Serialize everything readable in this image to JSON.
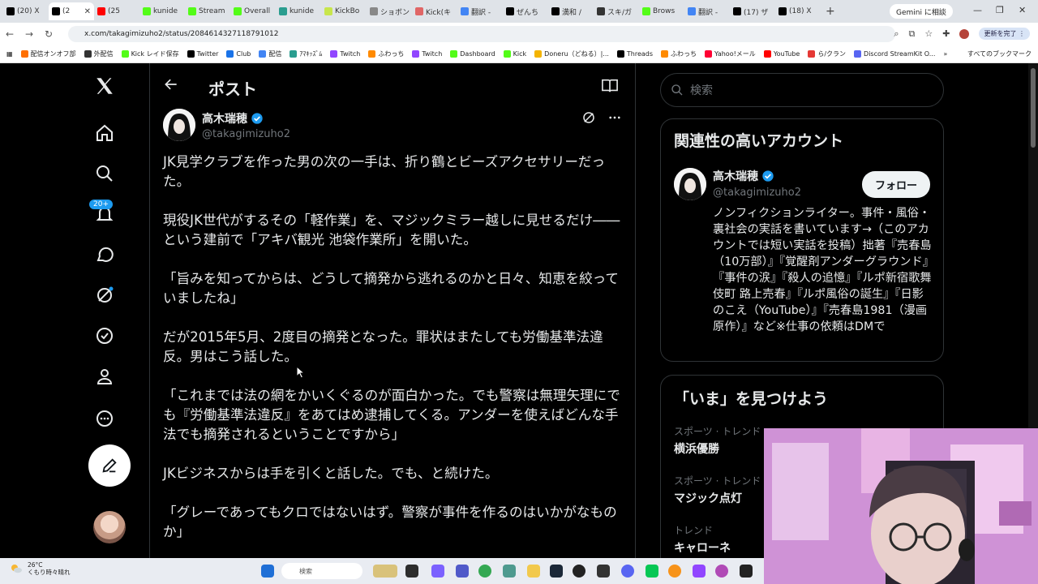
{
  "browser": {
    "tabs": [
      {
        "label": "(20) X",
        "color": "#000000"
      },
      {
        "label": "(2",
        "color": "#000000",
        "active": true
      },
      {
        "label": "(25",
        "color": "#ff0000"
      },
      {
        "label": "kunide",
        "color": "#53fc18"
      },
      {
        "label": "Stream",
        "color": "#53fc18"
      },
      {
        "label": "Overall",
        "color": "#53fc18"
      },
      {
        "label": "kunide",
        "color": "#2a9d8f"
      },
      {
        "label": "KickBo",
        "color": "#c8e64c"
      },
      {
        "label": "ショボン",
        "color": "#888888"
      },
      {
        "label": "Kick(キ",
        "color": "#e06666"
      },
      {
        "label": "翻訳 -",
        "color": "#4285f4"
      },
      {
        "label": "ぜんち",
        "color": "#000000"
      },
      {
        "label": "満和 /",
        "color": "#000000"
      },
      {
        "label": "スキ/ガ",
        "color": "#333333"
      },
      {
        "label": "Brows",
        "color": "#53fc18"
      },
      {
        "label": "翻訳 -",
        "color": "#4285f4"
      },
      {
        "label": "(17) ザ",
        "color": "#000000"
      },
      {
        "label": "(18) X",
        "color": "#000000"
      }
    ],
    "new_tab": "+",
    "gemini_label": "Gemini に相談",
    "url": "x.com/takagimizuho2/status/2084614327118791012",
    "update_label": "更新を完了 ⋮",
    "bookmarks": [
      {
        "label": "配信オンオフ部",
        "color": "#ff6f00"
      },
      {
        "label": "外配信",
        "color": "#333333"
      },
      {
        "label": "Kick レイド保存",
        "color": "#53fc18"
      },
      {
        "label": "Twitter",
        "color": "#000000"
      },
      {
        "label": "Club",
        "color": "#1a73e8"
      },
      {
        "label": "配信",
        "color": "#4285f4"
      },
      {
        "label": "ｱﾏｷｯｽﾞﾑ",
        "color": "#2a9d8f"
      },
      {
        "label": "Twitch",
        "color": "#9146ff"
      },
      {
        "label": "ふわっち",
        "color": "#ff8a00"
      },
      {
        "label": "Twitch",
        "color": "#9146ff"
      },
      {
        "label": "Dashboard",
        "color": "#53fc18"
      },
      {
        "label": "Kick",
        "color": "#53fc18"
      },
      {
        "label": "Doneru（どねる）|...",
        "color": "#f4b400"
      },
      {
        "label": "Threads",
        "color": "#000000"
      },
      {
        "label": "ふわっち",
        "color": "#ff8a00"
      },
      {
        "label": "Yahoo!メール",
        "color": "#ff0033"
      },
      {
        "label": "YouTube",
        "color": "#ff0000"
      },
      {
        "label": "ら/クラン",
        "color": "#e53935"
      },
      {
        "label": "Discord StreamKit O...",
        "color": "#5865f2"
      }
    ],
    "bookmarks_more": "»",
    "all_bookmarks": "すべてのブックマーク"
  },
  "x": {
    "nav": {
      "notifications_badge": "20+"
    },
    "header_title": "ポスト",
    "author": {
      "name": "高木瑞穂",
      "handle": "@takagimizuho2"
    },
    "tweet_text": "JK見学クラブを作った男の次の一手は、折り鶴とビーズアクセサリーだった。\n\n現役JK世代がするその「軽作業」を、マジックミラー越しに見せるだけ――という建前で「アキバ観光 池袋作業所」を開いた。\n\n「旨みを知ってからは、どうして摘発から逃れるのかと日々、知恵を絞っていましたね」\n\nだが2015年5月、2度目の摘発となった。罪状はまたしても労働基準法違反。男はこう話した。\n\n「これまでは法の網をかいくぐるのが面白かった。でも警察は無理矢理にでも『労働基準法違反』をあてはめ逮捕してくる。アンダーを使えばどんな手法でも摘発されるということですから」\n\nJKビジネスからは手を引くと話した。でも、と続けた。\n\n「グレーであってもクロではないはず。警察が事件を作るのはいかがなものか」",
    "search_placeholder": "検索",
    "related": {
      "title": "関連性の高いアカウント",
      "name": "高木瑞穂",
      "handle": "@takagimizuho2",
      "follow_label": "フォロー",
      "bio": "ノンフィクションライター。事件・風俗・裏社会の実話を書いています→（このアカウントでは短い実話を投稿）拙著『売春島（10万部）』『覚醒剤アンダーグラウンド』『事件の涙』『殺人の追憶』『ルポ新宿歌舞伎町 路上売春』『ルポ風俗の誕生』『日影のこえ（YouTube）』『売春島1981（漫画原作）』など※仕事の依頼はDMで"
    },
    "trends": {
      "title": "「いま」を見つけよう",
      "items": [
        {
          "category": "スポーツ · トレンド",
          "name": "横浜優勝"
        },
        {
          "category": "スポーツ · トレンド",
          "name": "マジック点灯"
        },
        {
          "category": "トレンド",
          "name": "キャローネ"
        }
      ]
    }
  },
  "taskbar": {
    "temperature": "26°C",
    "weather": "くもり時々晴れ",
    "search_placeholder": "検索"
  }
}
